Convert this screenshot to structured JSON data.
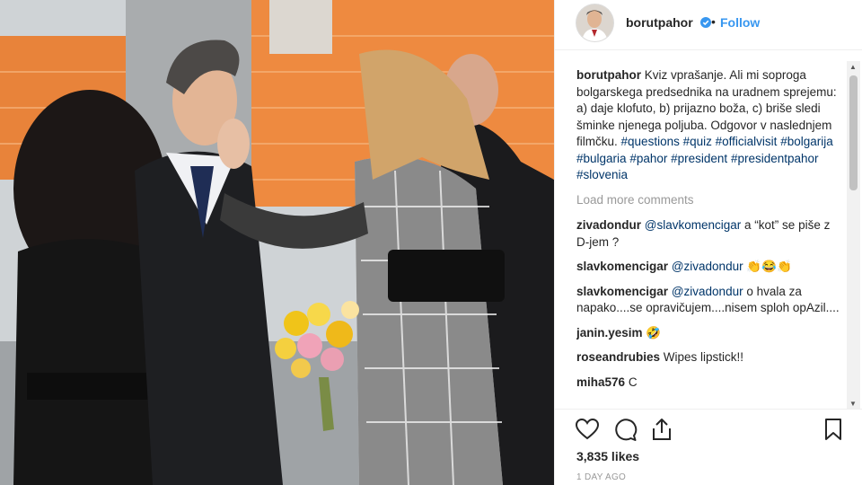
{
  "post": {
    "username": "borutpahor",
    "dot": "•",
    "follow_label": "Follow",
    "caption": {
      "user": "borutpahor",
      "text": "Kviz vprašanje. Ali mi soproga bolgarskega predsednika na uradnem sprejemu: a) daje klofuto, b) prijazno boža, c) briše sledi šminke njenega poljuba. Odgovor v naslednjem filmčku.",
      "hashtags": [
        "#questions",
        "#quiz",
        "#officialvisit",
        "#bolgarija",
        "#bulgaria",
        "#pahor",
        "#president",
        "#presidentpahor",
        "#slovenia"
      ]
    },
    "load_more_label": "Load more comments",
    "comments": [
      {
        "user": "zivadondur",
        "mention": "@slavkomencigar",
        "text": "a “kot” se piše z D-jem ?"
      },
      {
        "user": "slavkomencigar",
        "mention": "@zivadondur",
        "text": "👏😂👏"
      },
      {
        "user": "slavkomencigar",
        "mention": "@zivadondur",
        "text": "o hvala za napako....se opravičujem....nisem sploh opAzil...."
      },
      {
        "user": "janin.yesim",
        "mention": "",
        "text": "🤣"
      },
      {
        "user": "roseandrubies",
        "mention": "",
        "text": "Wipes lipstick!!"
      },
      {
        "user": "miha576",
        "mention": "",
        "text": "C"
      }
    ],
    "likes_label": "3,835 likes",
    "time_label": "1 DAY AGO"
  },
  "colors": {
    "accent": "#3897f0",
    "link": "#003569",
    "muted": "#999999",
    "text": "#262626"
  },
  "icons": [
    "verified-badge-icon",
    "heart-icon",
    "comment-icon",
    "share-icon",
    "bookmark-icon"
  ]
}
